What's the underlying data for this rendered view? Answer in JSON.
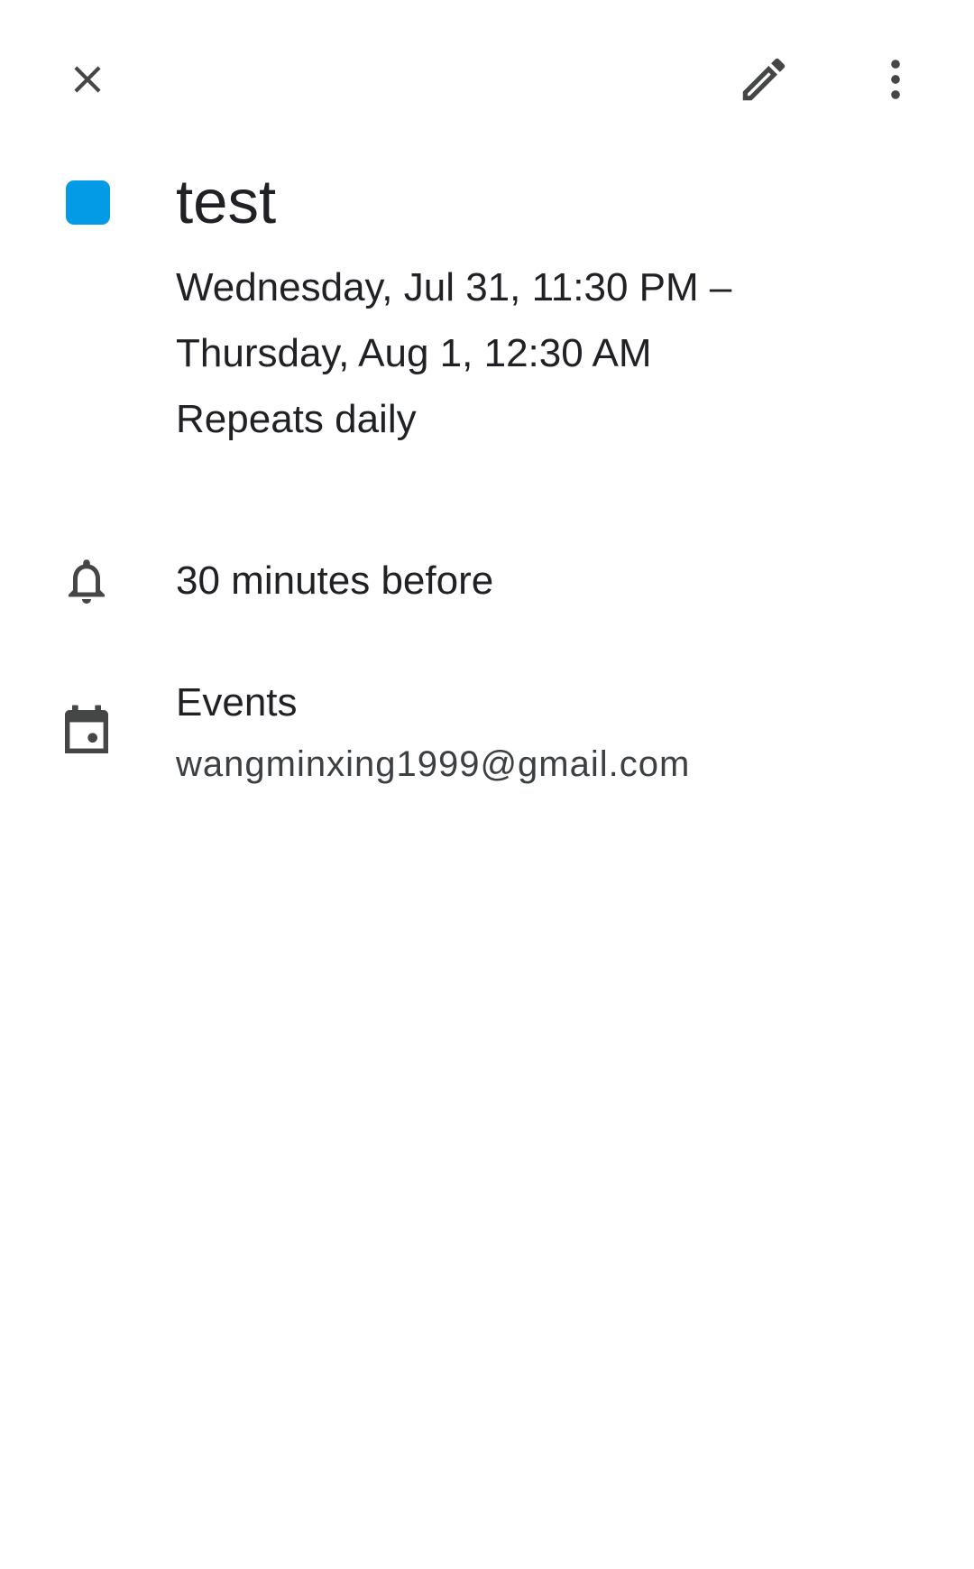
{
  "toolbar": {
    "close_icon": "close-icon",
    "edit_icon": "edit-pencil-icon",
    "more_icon": "more-vertical-icon"
  },
  "event": {
    "color": "#039BE5",
    "title": "test",
    "when_line1": "Wednesday, Jul 31, 11:30 PM –",
    "when_line2": "Thursday, Aug 1, 12:30 AM",
    "recurrence": "Repeats daily"
  },
  "notification": {
    "icon": "bell-icon",
    "text": "30 minutes before"
  },
  "calendar": {
    "icon": "calendar-icon",
    "name": "Events",
    "account": "wangminxing1999@gmail.com"
  },
  "colors": {
    "icon": "#444746",
    "text": "#202124",
    "secondary_text": "#3c4043"
  }
}
